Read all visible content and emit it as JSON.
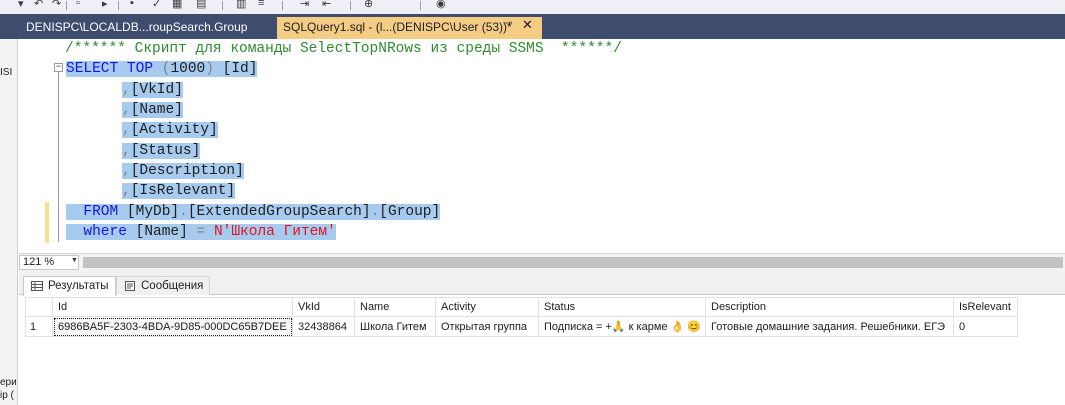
{
  "tabs": {
    "inactive_label": "DENISPC\\LOCALDB...roupSearch.Group",
    "active_label": "SQLQuery1.sql - (l...(DENISPC\\User (53))*",
    "pin_glyph": "⊸",
    "close_glyph": "✕"
  },
  "left_dock": {
    "fragment_top": "ISI",
    "fragment_bottom_1": "ери",
    "fragment_bottom_2": "ip ("
  },
  "editor": {
    "comment": "/****** Скрипт для команды SelectTopNRows из среды SSMS  ******/",
    "select_kw": "SELECT",
    "top_kw": "TOP",
    "top_value": "1000",
    "columns": [
      "[Id]",
      "[VkId]",
      "[Name]",
      "[Activity]",
      "[Status]",
      "[Description]",
      "[IsRelevant]"
    ],
    "from_kw": "FROM",
    "table_db": "[MyDb]",
    "table_schema": "[ExtendedGroupSearch]",
    "table_name": "[Group]",
    "where_kw": "where",
    "where_column": "[Name]",
    "where_op": "=",
    "where_value": "N'Школа Гитем'"
  },
  "zoom": {
    "value": "121 %",
    "arrow": "▼"
  },
  "results": {
    "tab_results": "Результаты",
    "tab_messages": "Сообщения",
    "columns": [
      "Id",
      "VkId",
      "Name",
      "Activity",
      "Status",
      "Description",
      "IsRelevant"
    ],
    "rows": [
      {
        "num": "1",
        "cells": [
          "6986BA5F-2303-4BDA-9D85-000DC65B7DEE",
          "32438864",
          "Школа Гитем",
          "Открытая группа",
          "Подписка = +🙏 к карме 👌 😊",
          "Готовые домашние задания. Решебники. ЕГЭ",
          "0"
        ]
      }
    ]
  },
  "colors": {
    "tabstrip": "#3e4c6e",
    "active_tab": "#f5cc84",
    "selection": "#a6cbee",
    "keyword": "#1515e0",
    "string": "#e0141e",
    "comment": "#2f8c2f"
  }
}
